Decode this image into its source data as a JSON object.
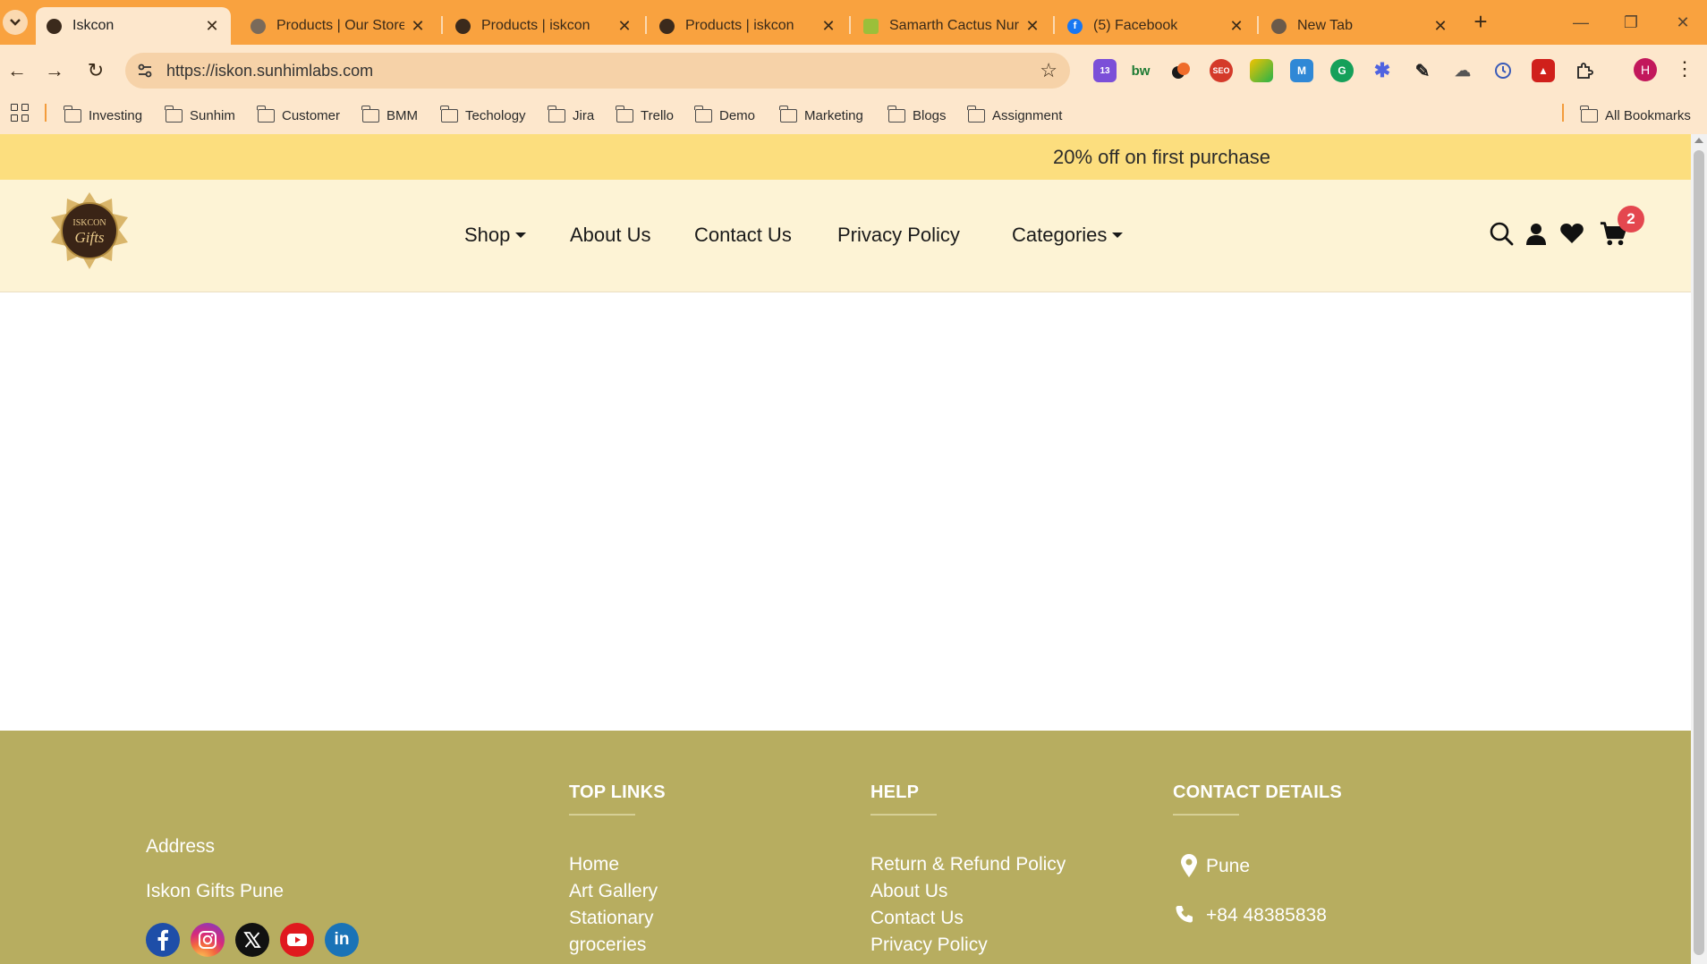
{
  "browser": {
    "tabs": [
      {
        "title": "Iskcon",
        "favicon": "iskcon-favicon",
        "active": true
      },
      {
        "title": "Products | Our Store",
        "favicon": "globe-favicon",
        "active": false
      },
      {
        "title": "Products | iskcon",
        "favicon": "iskcon-favicon",
        "active": false
      },
      {
        "title": "Products | iskcon",
        "favicon": "iskcon-favicon",
        "active": false
      },
      {
        "title": "Samarth Cactus Nurs",
        "favicon": "nursery-favicon",
        "active": false
      },
      {
        "title": "(5) Facebook",
        "favicon": "facebook-favicon",
        "active": false
      },
      {
        "title": "New Tab",
        "favicon": "chrome-favicon",
        "active": false
      }
    ],
    "address_url": "https://iskon.sunhimlabs.com",
    "extensions_badge": "13",
    "extensions_label_bw": "bw",
    "extensions_label_seo": "SEO",
    "profile_initial": "H",
    "bookmarks": [
      "Investing",
      "Sunhim",
      "Customer",
      "BMM",
      "Techology",
      "Jira",
      "Trello",
      "Demo",
      "Marketing",
      "Blogs",
      "Assignment"
    ],
    "all_bookmarks_label": "All Bookmarks"
  },
  "site": {
    "promo_text": "20% off on first purchase",
    "nav": {
      "shop": "Shop",
      "about": "About Us",
      "contact": "Contact Us",
      "privacy": "Privacy Policy",
      "categories": "Categories"
    },
    "cart_count": "2",
    "logo_text_top": "ISKCON",
    "logo_text_bottom": "Gifts",
    "colors": {
      "promo_bg": "#fcde7e",
      "header_bg": "#fdf3d5",
      "footer_bg": "#b7ad60",
      "badge": "#e4474f"
    }
  },
  "footer": {
    "address_label": "Address",
    "address_value": "Iskon Gifts Pune",
    "top_links_heading": "TOP LINKS",
    "top_links": [
      "Home",
      "Art Gallery",
      "Stationary",
      "groceries"
    ],
    "help_heading": "HELP",
    "help_links": [
      "Return & Refund Policy",
      "About Us",
      "Contact Us",
      "Privacy Policy"
    ],
    "contact_heading": "CONTACT DETAILS",
    "contact_city": "Pune",
    "contact_phone": "+84 48385838",
    "social": [
      "facebook-icon",
      "instagram-icon",
      "x-icon",
      "youtube-icon",
      "linkedin-icon"
    ]
  }
}
